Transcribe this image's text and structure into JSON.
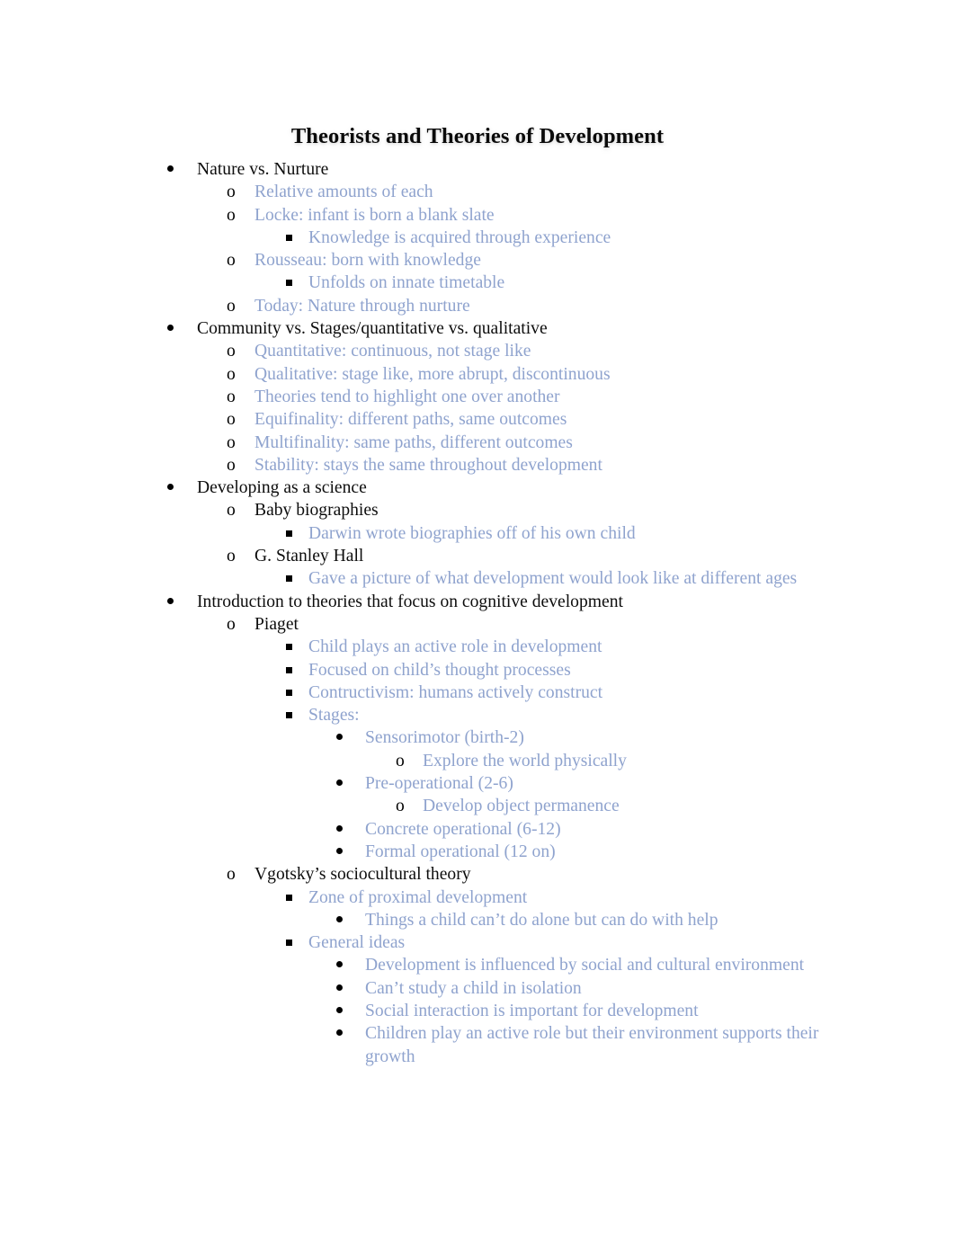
{
  "document": {
    "title": "Theorists and Theories of Development",
    "text_color_primary": "#0d0d0d",
    "text_color_secondary": "#8fa3ce",
    "page_background": "#ffffff"
  },
  "markers": {
    "level1": "•",
    "level2": "o",
    "level3": "▪",
    "level4": "•",
    "level5": "o"
  },
  "outline": [
    {
      "level": 1,
      "color": "black",
      "text": "Nature vs. Nurture"
    },
    {
      "level": 2,
      "color": "blue",
      "text": "Relative amounts of each"
    },
    {
      "level": 2,
      "color": "blue",
      "text": "Locke: infant is born a blank slate"
    },
    {
      "level": 3,
      "color": "blue",
      "text": "Knowledge is acquired through experience"
    },
    {
      "level": 2,
      "color": "blue",
      "text": "Rousseau: born with knowledge"
    },
    {
      "level": 3,
      "color": "blue",
      "text": "Unfolds on innate timetable"
    },
    {
      "level": 2,
      "color": "blue",
      "text": "Today: Nature through nurture"
    },
    {
      "level": 1,
      "color": "black",
      "text": "Community vs. Stages/quantitative vs. qualitative"
    },
    {
      "level": 2,
      "color": "blue",
      "text": "Quantitative: continuous, not stage like"
    },
    {
      "level": 2,
      "color": "blue",
      "text": "Qualitative: stage like, more abrupt, discontinuous"
    },
    {
      "level": 2,
      "color": "blue",
      "text": "Theories tend to highlight one over another"
    },
    {
      "level": 2,
      "color": "blue",
      "text": "Equifinality: different paths, same outcomes"
    },
    {
      "level": 2,
      "color": "blue",
      "text": "Multifinality: same paths, different outcomes"
    },
    {
      "level": 2,
      "color": "blue",
      "text": "Stability: stays the same throughout development"
    },
    {
      "level": 1,
      "color": "black",
      "text": "Developing as a science"
    },
    {
      "level": 2,
      "color": "black",
      "text": "Baby biographies"
    },
    {
      "level": 3,
      "color": "blue",
      "text": "Darwin wrote biographies off of his own child"
    },
    {
      "level": 2,
      "color": "black",
      "text": "G. Stanley Hall"
    },
    {
      "level": 3,
      "color": "blue",
      "text": "Gave a picture of what development would look like at different ages"
    },
    {
      "level": 1,
      "color": "black",
      "text": "Introduction to theories that focus on cognitive development"
    },
    {
      "level": 2,
      "color": "black",
      "text": "Piaget"
    },
    {
      "level": 3,
      "color": "blue",
      "text": "Child plays an active role in development"
    },
    {
      "level": 3,
      "color": "blue",
      "text": "Focused on child’s thought processes"
    },
    {
      "level": 3,
      "color": "blue",
      "text": "Contructivism: humans actively construct"
    },
    {
      "level": 3,
      "color": "blue",
      "text": "Stages:"
    },
    {
      "level": 4,
      "color": "blue",
      "text": "Sensorimotor (birth-2)"
    },
    {
      "level": 5,
      "color": "blue",
      "text": "Explore the world physically"
    },
    {
      "level": 4,
      "color": "blue",
      "text": "Pre-operational (2-6)"
    },
    {
      "level": 5,
      "color": "blue",
      "text": "Develop object permanence"
    },
    {
      "level": 4,
      "color": "blue",
      "text": "Concrete operational (6-12)"
    },
    {
      "level": 4,
      "color": "blue",
      "text": "Formal operational (12 on)"
    },
    {
      "level": 2,
      "color": "black",
      "text": "Vgotsky’s sociocultural theory"
    },
    {
      "level": 3,
      "color": "blue",
      "text": "Zone of proximal development"
    },
    {
      "level": 4,
      "color": "blue",
      "text": "Things a child can’t do alone but can do with help"
    },
    {
      "level": 3,
      "color": "blue",
      "text": "General ideas"
    },
    {
      "level": 4,
      "color": "blue",
      "text": "Development is influenced by social and cultural environment"
    },
    {
      "level": 4,
      "color": "blue",
      "text": "Can’t study a child in isolation"
    },
    {
      "level": 4,
      "color": "blue",
      "text": "Social interaction is important for development"
    },
    {
      "level": 4,
      "color": "blue",
      "text": "Children play an active role but their environment supports their growth"
    }
  ]
}
